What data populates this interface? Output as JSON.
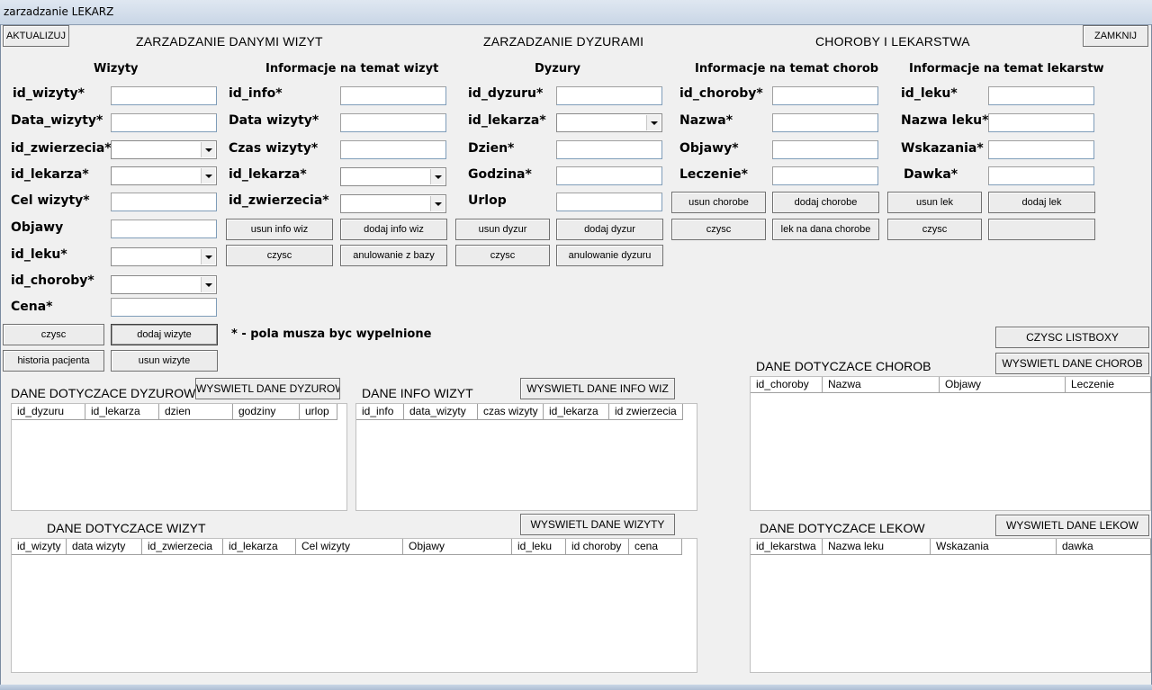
{
  "window": {
    "title": "zarzadzanie LEKARZ"
  },
  "top": {
    "refresh_label": "AKTUALIZUJ",
    "close_label": "ZAMKNIJ",
    "title_visits": "ZARZADZANIE DANYMI WIZYT",
    "title_duty": "ZARZADZANIE DYZURAMI",
    "title_diseases": "CHOROBY I LEKARSTWA"
  },
  "visits": {
    "heading": "Wizyty",
    "labels": [
      "id_wizyty*",
      "Data_wizyty*",
      "id_zwierzecia*",
      "id_lekarza*",
      "Cel wizyty*",
      "Objawy",
      "id_leku*",
      "id_choroby*",
      "Cena*"
    ],
    "clear_label": "czysc",
    "add_label": "dodaj wizyte",
    "history_label": "historia pacjenta",
    "delete_label": "usun wizyte",
    "required_note": "* - pola musza byc wypelnione"
  },
  "visit_info": {
    "heading": "Informacje na temat wizyt",
    "labels": [
      "id_info*",
      "Data wizyty*",
      "Czas wizyty*",
      "id_lekarza*",
      "id_zwierzecia*"
    ],
    "delete_label": "usun info wiz",
    "add_label": "dodaj info wiz",
    "clear_label": "czysc",
    "cancel_label": "anulowanie z bazy"
  },
  "duty": {
    "heading": "Dyzury",
    "labels": [
      "id_dyzuru*",
      "id_lekarza*",
      "Dzien*",
      "Godzina*",
      "Urlop"
    ],
    "delete_label": "usun dyzur",
    "add_label": "dodaj dyzur",
    "clear_label": "czysc",
    "cancel_label": "anulowanie dyzuru"
  },
  "diseases": {
    "heading": "Informacje na temat chorob",
    "labels": [
      "id_choroby*",
      "Nazwa*",
      "Objawy*",
      "Leczenie*"
    ],
    "delete_label": "usun chorobe",
    "add_label": "dodaj chorobe",
    "clear_label": "czysc",
    "drug_for_disease_label": "lek na dana chorobe"
  },
  "drugs": {
    "heading": "Informacje na temat lekarstw",
    "labels": [
      "id_leku*",
      "Nazwa leku*",
      "Wskazania*",
      "Dawka*"
    ],
    "delete_label": "usun lek",
    "add_label": "dodaj lek",
    "clear_label": "czysc"
  },
  "lists": {
    "clear_listboxes_label": "CZYSC LISTBOXY",
    "duty_title": "DANE DOTYCZACE DYZUROW",
    "duty_show_label": "WYSWIETL DANE DYZUROW",
    "duty_columns": [
      "id_dyzuru",
      "id_lekarza",
      "dzien",
      "godziny",
      "urlop"
    ],
    "info_title": "DANE INFO WIZYT",
    "info_show_label": "WYSWIETL DANE INFO WIZ",
    "info_columns": [
      "id_info",
      "data_wizyty",
      "czas wizyty",
      "id_lekarza",
      "id zwierzecia"
    ],
    "visits_title": "DANE DOTYCZACE WIZYT",
    "visits_show_label": "WYSWIETL DANE WIZYTY",
    "visits_columns": [
      "id_wizyty",
      "data wizyty",
      "id_zwierzecia",
      "id_lekarza",
      "Cel wizyty",
      "Objawy",
      "id_leku",
      "id choroby",
      "cena"
    ],
    "diseases_title": "DANE DOTYCZACE CHOROB",
    "diseases_show_label": "WYSWIETL DANE CHOROB",
    "diseases_columns": [
      "id_choroby",
      "Nazwa",
      "Objawy",
      "Leczenie"
    ],
    "drugs_title": "DANE DOTYCZACE LEKOW",
    "drugs_show_label": "WYSWIETL DANE LEKOW",
    "drugs_columns": [
      "id_lekarstwa",
      "Nazwa leku",
      "Wskazania",
      "dawka"
    ]
  }
}
